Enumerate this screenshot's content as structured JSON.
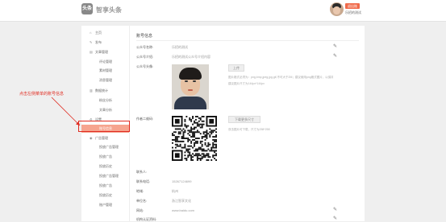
{
  "header": {
    "logo_icon_text": "头条",
    "app_name": "智享头条",
    "user_badge": "退出账",
    "user_name": "乐招的测试"
  },
  "sidebar": {
    "items": [
      {
        "icon": "home-icon",
        "glyph": "⌂",
        "label": "主页"
      },
      {
        "icon": "publish-icon",
        "glyph": "✎",
        "label": "发布"
      },
      {
        "icon": "article-icon",
        "glyph": "▤",
        "label": "文章管理"
      },
      {
        "label": "评论管理"
      },
      {
        "label": "素材管理"
      },
      {
        "label": "消息管理"
      },
      {
        "icon": "stats-icon",
        "glyph": "▥",
        "label": "数据统计"
      },
      {
        "label": "粉丝分析"
      },
      {
        "label": "文章分析"
      },
      {
        "icon": "settings-icon",
        "glyph": "⚙",
        "label": "设置"
      },
      {
        "label": "账号信息"
      },
      {
        "icon": "ads-icon",
        "glyph": "◉",
        "label": "广告管理"
      },
      {
        "label": "投放广告管理"
      },
      {
        "label": "投放广告"
      },
      {
        "label": "投放历史"
      },
      {
        "label": "投放广告管理"
      },
      {
        "label": "投放广告"
      },
      {
        "label": "投放历史"
      },
      {
        "label": "账户管理"
      }
    ]
  },
  "content": {
    "title": "账号信息",
    "fields": {
      "name_label": "公众号名称:",
      "name_value": "乐招的测试",
      "intro_label": "公众号介绍:",
      "intro_value": "乐招的测试公众号介绍内容",
      "avatar_label": "公众号头像:",
      "upload_button": "上传",
      "avatar_hint_1": "图片格式必须为：png,bmp,jpeg,jpg,gif,不可大于2M；建议使用png格式图片，以保持最佳效果",
      "avatar_hint_2": "建议图片尺寸为144px*144px",
      "qrcode_label": "作者二维码:",
      "download_button": "下载更多尺寸",
      "qrcode_hint": "双击图片可下载，尺寸为258*258",
      "contact_label": "联系人:",
      "phone_label": "联系电话:",
      "phone_value": "15267124699",
      "area_label": "地域:",
      "area_value": "杭州",
      "company_label": "单位名:",
      "company_value": "浙江智享文化",
      "site_label": "网站:",
      "site_value": "www.baidu.com",
      "org_label": "机构认证资料:"
    }
  },
  "annotation": {
    "text": "点击左侧菜单的账号信息"
  },
  "colors": {
    "accent": "#f6a48f",
    "annotation": "#e02b20",
    "badge": "#f06a4a"
  }
}
